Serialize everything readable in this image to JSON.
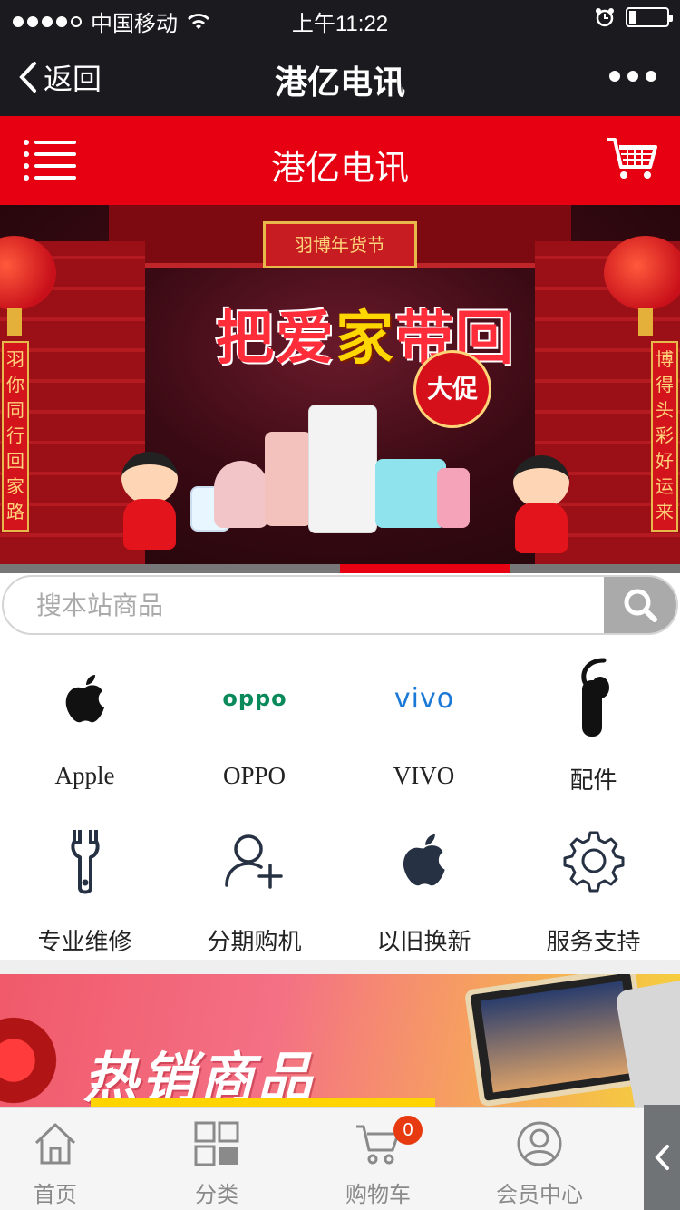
{
  "status_bar": {
    "carrier": "中国移动",
    "time": "上午11:22"
  },
  "nav": {
    "back_label": "返回",
    "title": "港亿电讯"
  },
  "header": {
    "title": "港亿电讯"
  },
  "banner": {
    "plaque": "羽博年货节",
    "slogan_a": "把爱",
    "slogan_b": "家",
    "slogan_c": "带回",
    "badge": "大促",
    "couplet_left": "羽你同行回家路",
    "couplet_right": "博得头彩好运来"
  },
  "search": {
    "placeholder": "搜本站商品"
  },
  "categories": [
    {
      "label": "Apple",
      "icon": "apple-logo-icon"
    },
    {
      "label": "OPPO",
      "icon": "oppo-logo-icon"
    },
    {
      "label": "VIVO",
      "icon": "vivo-logo-icon"
    },
    {
      "label": "配件",
      "icon": "bluetooth-headset-icon"
    },
    {
      "label": "专业维修",
      "icon": "wrench-icon"
    },
    {
      "label": "分期购机",
      "icon": "user-add-icon"
    },
    {
      "label": "以旧换新",
      "icon": "apple-logo-icon"
    },
    {
      "label": "服务支持",
      "icon": "gear-icon"
    }
  ],
  "brand_text": {
    "oppo": "oppo",
    "vivo": "vivo"
  },
  "hot_banner": {
    "title": "热销商品"
  },
  "tabbar": {
    "items": [
      {
        "label": "首页",
        "icon": "home-icon"
      },
      {
        "label": "分类",
        "icon": "category-grid-icon"
      },
      {
        "label": "购物车",
        "icon": "cart-icon"
      },
      {
        "label": "会员中心",
        "icon": "user-icon"
      }
    ],
    "cart_count": "0"
  },
  "colors": {
    "brand_red": "#e60012",
    "dark_bar": "#1b1b1f",
    "badge_orange": "#e83a10"
  }
}
